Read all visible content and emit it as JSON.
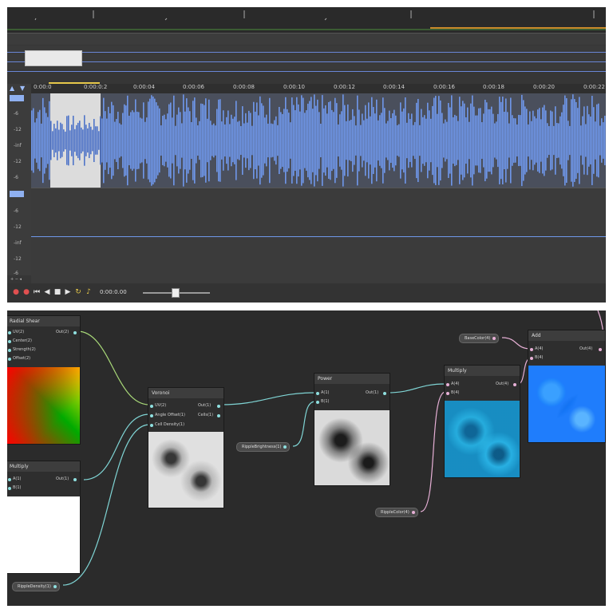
{
  "audio_editor": {
    "ruler_labels": [
      "0:00:0",
      "0:00:0:2",
      "0:00:04",
      "0:00:06",
      "0:00:08",
      "0:00:10",
      "0:00:12",
      "0:00:14",
      "0:00:16",
      "0:00:18",
      "0:00:20",
      "0:00:22"
    ],
    "db_labels_top": [
      "-6",
      "-12",
      "-inf",
      "-12",
      "-6"
    ],
    "db_labels_bottom": [
      "-6",
      "-12",
      "-inf",
      "-12",
      "-6"
    ],
    "time_display": "0:00:0.00",
    "colors": {
      "wave": "#6f97ea",
      "selection": "#dcdcdc",
      "accent": "#e6c84a"
    }
  },
  "node_graph": {
    "nodes": {
      "radial_shear": {
        "title": "Radial Shear",
        "inputs": [
          "UV(2)",
          "Center(2)",
          "Strength(2)",
          "Offset(2)"
        ],
        "outputs": [
          "Out(2)"
        ]
      },
      "multiply_left": {
        "title": "Multiply",
        "inputs": [
          "A(1)",
          "B(1)"
        ],
        "outputs": [
          "Out(1)"
        ]
      },
      "voronoi": {
        "title": "Voronoi",
        "inputs": [
          "UV(2)",
          "Angle Offset(1)",
          "Cell Density(1)"
        ],
        "outputs": [
          "Out(1)",
          "Cells(1)"
        ]
      },
      "power": {
        "title": "Power",
        "inputs": [
          "A(1)",
          "B(1)"
        ],
        "outputs": [
          "Out(1)"
        ]
      },
      "multiply_right": {
        "title": "Multiply",
        "inputs": [
          "A(4)",
          "B(4)"
        ],
        "outputs": [
          "Out(4)"
        ]
      },
      "add": {
        "title": "Add",
        "inputs": [
          "A(4)",
          "B(4)"
        ],
        "outputs": [
          "Out(4)"
        ]
      }
    },
    "properties": {
      "ripple_density": "RippleDensity(1)",
      "ripple_brightness": "RippleBrightness(1)",
      "ripple_color": "RippleColor(4)",
      "base_color": "BaseColor(4)"
    },
    "colors": {
      "wire_cyan": "#7fd4d4",
      "wire_green": "#a8d878",
      "wire_pink": "#e7b0d6"
    }
  }
}
